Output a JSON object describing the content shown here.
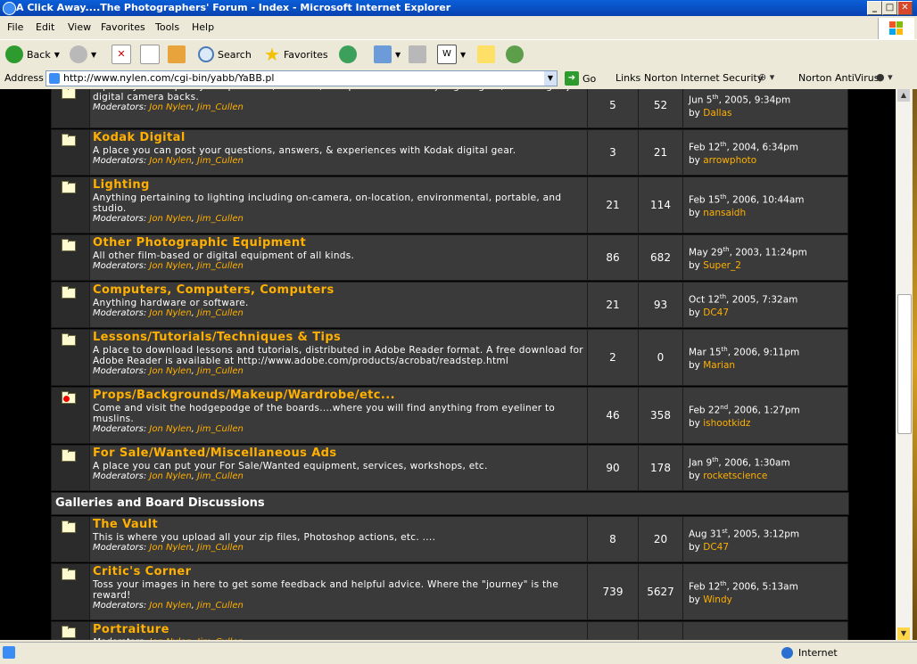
{
  "window": {
    "title": "A Click Away....The Photographers' Forum - Index - Microsoft Internet Explorer"
  },
  "menu": [
    "File",
    "Edit",
    "View",
    "Favorites",
    "Tools",
    "Help"
  ],
  "toolbar": {
    "back": "Back",
    "search": "Search",
    "favorites": "Favorites"
  },
  "address": {
    "label": "Address",
    "url": "http://www.nylen.com/cgi-bin/yabb/YaBB.pl",
    "go": "Go",
    "links": "Links",
    "norton_security": "Norton Internet Security",
    "norton_av": "Norton AntiVirus"
  },
  "status": {
    "zone": "Internet"
  },
  "forum": {
    "mod_label": "Moderators:",
    "mods": [
      "Jon Nylen",
      "Jim_Cullen"
    ],
    "category2": "Galleries and Board Discussions",
    "rows1": [
      {
        "name": "",
        "desc": "A place you can post your questions, answers, & experiences with Fuji digital gear, including Fuji digital camera backs.",
        "topics": "5",
        "posts": "52",
        "date_pre": "Jun 5",
        "date_sup": "th",
        "date_post": ", 2005, 9:34pm",
        "by": "by",
        "user": "Dallas",
        "icon": "folder"
      },
      {
        "name": "Kodak Digital",
        "desc": "A place you can post your questions, answers, & experiences with Kodak digital gear.",
        "topics": "3",
        "posts": "21",
        "date_pre": "Feb 12",
        "date_sup": "th",
        "date_post": ", 2004, 6:34pm",
        "by": "by",
        "user": "arrowphoto",
        "icon": "folder"
      },
      {
        "name": "Lighting",
        "desc": "Anything pertaining to lighting including on-camera, on-location, environmental, portable, and studio.",
        "topics": "21",
        "posts": "114",
        "date_pre": "Feb 15",
        "date_sup": "th",
        "date_post": ", 2006, 10:44am",
        "by": "by",
        "user": "nansaidh",
        "icon": "folder"
      },
      {
        "name": "Other Photographic Equipment",
        "desc": "All other film-based or digital equipment of all kinds.",
        "topics": "86",
        "posts": "682",
        "date_pre": "May 29",
        "date_sup": "th",
        "date_post": ", 2003, 11:24pm",
        "by": "by",
        "user": "Super_2",
        "icon": "folder"
      },
      {
        "name": "Computers, Computers, Computers",
        "desc": "Anything hardware or software.",
        "topics": "21",
        "posts": "93",
        "date_pre": "Oct 12",
        "date_sup": "th",
        "date_post": ", 2005, 7:32am",
        "by": "by",
        "user": "DC47",
        "icon": "folder"
      },
      {
        "name": "Lessons/Tutorials/Techniques & Tips",
        "desc": "A place to download lessons and tutorials, distributed in Adobe Reader format. A free download for Adobe Reader is available at http://www.adobe.com/products/acrobat/readstep.html",
        "topics": "2",
        "posts": "0",
        "date_pre": "Mar 15",
        "date_sup": "th",
        "date_post": ", 2006, 9:11pm",
        "by": "by",
        "user": "Marian",
        "icon": "folder"
      },
      {
        "name": "Props/Backgrounds/Makeup/Wardrobe/etc...",
        "desc": "Come and visit the hodgepodge of the boards....where you will find anything from eyeliner to muslins.",
        "topics": "46",
        "posts": "358",
        "date_pre": "Feb 22",
        "date_sup": "nd",
        "date_post": ", 2006, 1:27pm",
        "by": "by",
        "user": "ishootkidz",
        "icon": "folder-new"
      },
      {
        "name": "For Sale/Wanted/Miscellaneous Ads",
        "desc": "A place you can put your For Sale/Wanted equipment, services, workshops, etc.",
        "topics": "90",
        "posts": "178",
        "date_pre": "Jan 9",
        "date_sup": "th",
        "date_post": ", 2006, 1:30am",
        "by": "by",
        "user": "rocketscience",
        "icon": "folder"
      }
    ],
    "rows2": [
      {
        "name": "The Vault",
        "desc": "This is where you upload all your zip files, Photoshop actions, etc. ....",
        "topics": "8",
        "posts": "20",
        "date_pre": "Aug 31",
        "date_sup": "st",
        "date_post": ", 2005, 3:12pm",
        "by": "by",
        "user": "DC47",
        "icon": "folder"
      },
      {
        "name": "Critic's Corner",
        "desc": "Toss your images in here to get some feedback and helpful advice. Where the \"journey\" is the reward!",
        "topics": "739",
        "posts": "5627",
        "date_pre": "Feb 12",
        "date_sup": "th",
        "date_post": ", 2006, 5:13am",
        "by": "by",
        "user": "Windy",
        "icon": "folder"
      },
      {
        "name": "Portraiture",
        "desc": "",
        "topics": "",
        "posts": "",
        "date_pre": "",
        "date_sup": "",
        "date_post": "",
        "by": "",
        "user": "",
        "icon": "folder"
      }
    ]
  }
}
